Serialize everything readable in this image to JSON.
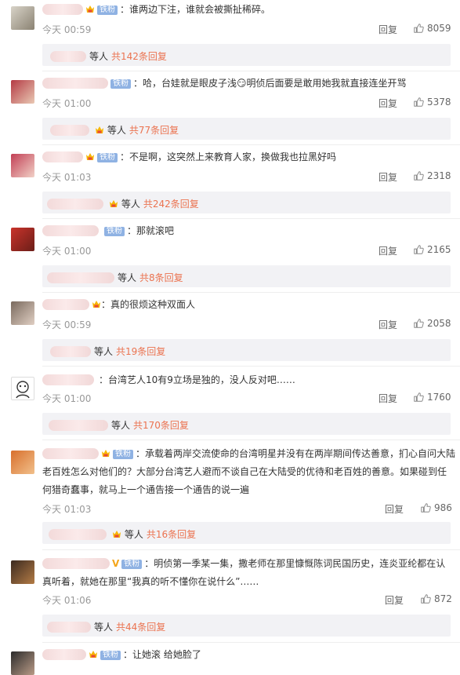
{
  "ui": {
    "reply_label": "回复",
    "badge_label": "铁粉",
    "others_label": "等人",
    "accent_color": "#eb7350",
    "badge_color": "#8fb2e3"
  },
  "comments": [
    {
      "text": "：谁两边下注，谁就会被撕扯稀碎。",
      "time": "今天 00:59",
      "likes": "8059",
      "replies": "共142条回复"
    },
    {
      "text": "：哈，台娃就是眼皮子浅😏明侦后面要是敢用她我就直接连坐开骂",
      "time": "今天 01:00",
      "likes": "5378",
      "replies": "共77条回复"
    },
    {
      "text": "：不是啊，这突然上来教育人家，换做我也拉黑好吗",
      "time": "今天 01:03",
      "likes": "2318",
      "replies": "共242条回复"
    },
    {
      "text": "：那就滚吧",
      "time": "今天 01:00",
      "likes": "2165",
      "replies": "共8条回复"
    },
    {
      "text": "：真的很烦这种双面人",
      "time": "今天 00:59",
      "likes": "2058",
      "replies": "共19条回复"
    },
    {
      "text": "：台湾艺人10有9立场是独的，没人反对吧……",
      "time": "今天 01:00",
      "likes": "1760",
      "replies": "共170条回复"
    },
    {
      "text_line1": "：承载着两岸交流使命的台湾明星并没有在两岸期间传达善意，扪心自问大陆",
      "text_line2": "老百姓怎么对他们的？大部分台湾艺人避而不谈自己在大陆受的优待和老百姓的善意。如果碰到任",
      "text_line3": "何猎奇蠢事，就马上一个通告接一个通告的说一遍",
      "time": "今天 01:03",
      "likes": "986",
      "replies": "共16条回复"
    },
    {
      "text_line1": "：明侦第一季某一集，撒老师在那里慷慨陈词民国历史，连炎亚纶都在认",
      "text_line2": "真听着，就她在那里“我真的听不懂你在说什么”……",
      "time": "今天 01:06",
      "likes": "872",
      "replies": "共44条回复"
    },
    {
      "text": "：让她滚 给她脸了"
    }
  ]
}
